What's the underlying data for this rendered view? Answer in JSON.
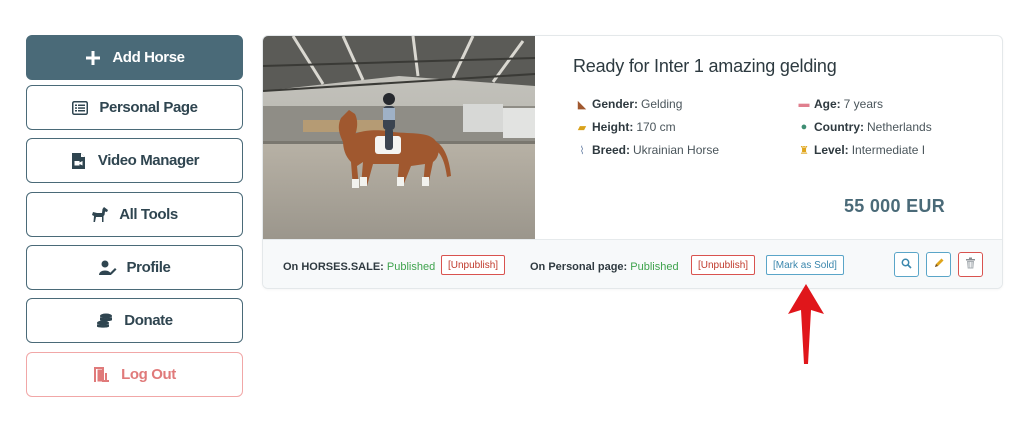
{
  "sidebar": {
    "items": [
      {
        "label": "Add Horse",
        "icon": "plus-icon"
      },
      {
        "label": "Personal Page",
        "icon": "list-icon"
      },
      {
        "label": "Video Manager",
        "icon": "video-file-icon"
      },
      {
        "label": "All Tools",
        "icon": "horse-icon"
      },
      {
        "label": "Profile",
        "icon": "user-edit-icon"
      },
      {
        "label": "Donate",
        "icon": "coins-icon"
      },
      {
        "label": "Log Out",
        "icon": "door-exit-icon"
      }
    ]
  },
  "listing": {
    "title": "Ready for Inter 1 amazing gelding",
    "attributes": {
      "gender": {
        "label": "Gender:",
        "value": "Gelding"
      },
      "height": {
        "label": "Height:",
        "value": "170 cm"
      },
      "breed": {
        "label": "Breed:",
        "value": "Ukrainian Horse"
      },
      "age": {
        "label": "Age:",
        "value": "7 years"
      },
      "country": {
        "label": "Country:",
        "value": "Netherlands"
      },
      "level": {
        "label": "Level:",
        "value": "Intermediate I"
      }
    },
    "price": "55 000 EUR"
  },
  "footer": {
    "horses_sale_label": "On HORSES.SALE:",
    "horses_sale_status": "Published",
    "unpublish_1": "[Unpublish]",
    "personal_label": "On Personal page:",
    "personal_status": "Published",
    "unpublish_2": "[Unpublish]",
    "mark_sold": "[Mark as Sold]",
    "actions": [
      "search-icon",
      "pencil-icon",
      "trash-icon"
    ]
  },
  "colors": {
    "primary": "#4a6a78",
    "published": "#3fa34d",
    "danger": "#d9534f",
    "info": "#5aa5c8",
    "annotation_arrow": "#e0161b"
  }
}
